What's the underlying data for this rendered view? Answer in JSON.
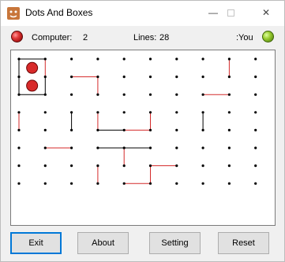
{
  "window": {
    "title": "Dots And Boxes",
    "minimize_icon": "minimize-icon",
    "maximize_icon": "maximize-icon",
    "close_icon": "close-icon"
  },
  "status": {
    "computer_label": "Computer:",
    "computer_score": "2",
    "lines_label": "Lines:",
    "lines_count": "28",
    "you_label": ":You",
    "computer_color": "#d82a2a",
    "you_color": "#8cc63f"
  },
  "board": {
    "cols": 10,
    "rows": 7,
    "line_color": "#d42a2a",
    "completed_line_color": "#000000",
    "lines": [
      {
        "from": [
          0,
          0
        ],
        "to": [
          1,
          0
        ],
        "owner": "black"
      },
      {
        "from": [
          0,
          0
        ],
        "to": [
          0,
          1
        ],
        "owner": "black"
      },
      {
        "from": [
          1,
          0
        ],
        "to": [
          1,
          1
        ],
        "owner": "red"
      },
      {
        "from": [
          0,
          1
        ],
        "to": [
          0,
          2
        ],
        "owner": "black"
      },
      {
        "from": [
          1,
          1
        ],
        "to": [
          1,
          2
        ],
        "owner": "black"
      },
      {
        "from": [
          0,
          2
        ],
        "to": [
          1,
          2
        ],
        "owner": "black"
      },
      {
        "from": [
          2,
          1
        ],
        "to": [
          3,
          1
        ],
        "owner": "red"
      },
      {
        "from": [
          3,
          1
        ],
        "to": [
          3,
          2
        ],
        "owner": "red"
      },
      {
        "from": [
          8,
          0
        ],
        "to": [
          8,
          1
        ],
        "owner": "red"
      },
      {
        "from": [
          7,
          2
        ],
        "to": [
          8,
          2
        ],
        "owner": "red"
      },
      {
        "from": [
          0,
          3
        ],
        "to": [
          0,
          4
        ],
        "owner": "red"
      },
      {
        "from": [
          2,
          3
        ],
        "to": [
          2,
          4
        ],
        "owner": "black"
      },
      {
        "from": [
          3,
          3
        ],
        "to": [
          3,
          4
        ],
        "owner": "red"
      },
      {
        "from": [
          3,
          4
        ],
        "to": [
          4,
          4
        ],
        "owner": "black"
      },
      {
        "from": [
          4,
          4
        ],
        "to": [
          5,
          4
        ],
        "owner": "red"
      },
      {
        "from": [
          5,
          3
        ],
        "to": [
          5,
          4
        ],
        "owner": "red"
      },
      {
        "from": [
          7,
          3
        ],
        "to": [
          7,
          4
        ],
        "owner": "black"
      },
      {
        "from": [
          1,
          5
        ],
        "to": [
          2,
          5
        ],
        "owner": "red"
      },
      {
        "from": [
          3,
          5
        ],
        "to": [
          4,
          5
        ],
        "owner": "black"
      },
      {
        "from": [
          4,
          5
        ],
        "to": [
          5,
          5
        ],
        "owner": "black"
      },
      {
        "from": [
          4,
          5
        ],
        "to": [
          4,
          6
        ],
        "owner": "red"
      },
      {
        "from": [
          3,
          6
        ],
        "to": [
          3,
          7
        ],
        "owner": "red"
      },
      {
        "from": [
          4,
          7
        ],
        "to": [
          5,
          7
        ],
        "owner": "red"
      },
      {
        "from": [
          5,
          6
        ],
        "to": [
          5,
          7
        ],
        "owner": "red"
      },
      {
        "from": [
          5,
          6
        ],
        "to": [
          6,
          6
        ],
        "owner": "red"
      }
    ],
    "captured_boxes": [
      {
        "col": 0,
        "row": 0,
        "owner": "computer"
      },
      {
        "col": 0,
        "row": 1,
        "owner": "computer"
      }
    ]
  },
  "buttons": {
    "exit_label": "Exit",
    "about_label": "About",
    "setting_label": "Setting",
    "reset_label": "Reset"
  }
}
